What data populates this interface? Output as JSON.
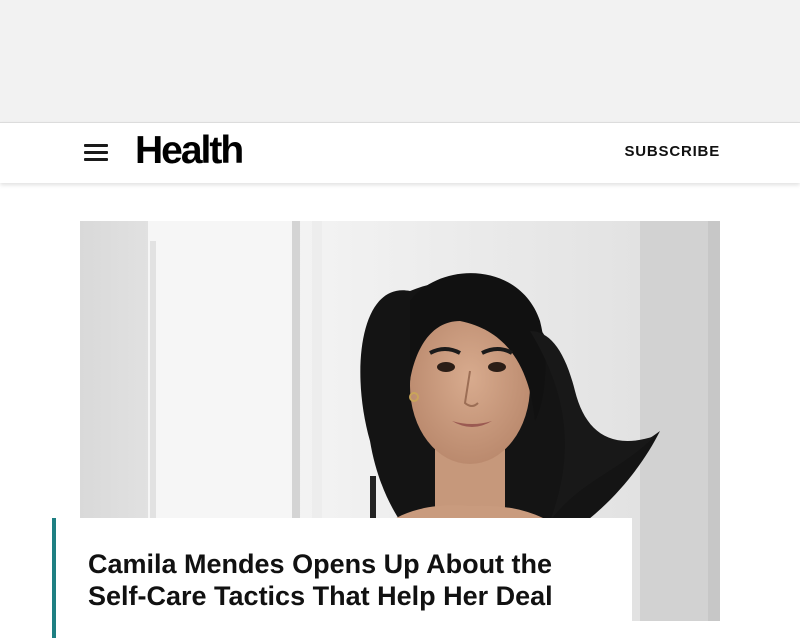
{
  "ad": {},
  "header": {
    "logo": "Health",
    "subscribe_label": "SUBSCRIBE",
    "menu_icon": "hamburger-menu-icon"
  },
  "hero": {
    "image_subject": "portrait photo"
  },
  "article": {
    "title": "Camila Mendes Opens Up About the Self-Care Tactics That Help Her Deal"
  },
  "colors": {
    "ad_background": "#f2f2f2",
    "accent_bar": "#1e7f82",
    "text": "#111111"
  }
}
